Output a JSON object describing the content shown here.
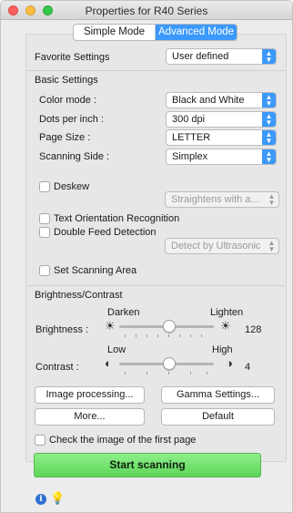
{
  "window": {
    "title": "Properties for R40 Series"
  },
  "mode_tabs": [
    {
      "label": "Simple Mode"
    },
    {
      "label": "Advanced Mode"
    }
  ],
  "favorite": {
    "label": "Favorite Settings",
    "value": "User defined"
  },
  "basic": {
    "heading": "Basic Settings",
    "color_mode": {
      "label": "Color mode :",
      "value": "Black and White"
    },
    "dpi": {
      "label": "Dots per inch :",
      "value": "300 dpi"
    },
    "page_size": {
      "label": "Page Size :",
      "value": "LETTER"
    },
    "scanning_side": {
      "label": "Scanning Side :",
      "value": "Simplex"
    }
  },
  "deskew": {
    "label": "Deskew",
    "option": "Straightens with a..."
  },
  "text_orientation": {
    "label": "Text Orientation Recognition"
  },
  "double_feed": {
    "label": "Double Feed Detection",
    "option": "Detect by Ultrasonic"
  },
  "scanning_area": {
    "label": "Set Scanning Area"
  },
  "brightness_contrast": {
    "heading": "Brightness/Contrast",
    "brightness": {
      "label": "Brightness :",
      "left": "Darken",
      "right": "Lighten",
      "value": "128"
    },
    "contrast": {
      "label": "Contrast :",
      "left": "Low",
      "right": "High",
      "value": "4"
    }
  },
  "buttons": {
    "image_processing": "Image processing...",
    "gamma": "Gamma Settings...",
    "more": "More...",
    "default": "Default"
  },
  "check_first_page": {
    "label": "Check the image of the first page"
  },
  "start_scanning": "Start scanning",
  "icons": {
    "info": "info-icon",
    "help": "lightbulb-icon"
  }
}
